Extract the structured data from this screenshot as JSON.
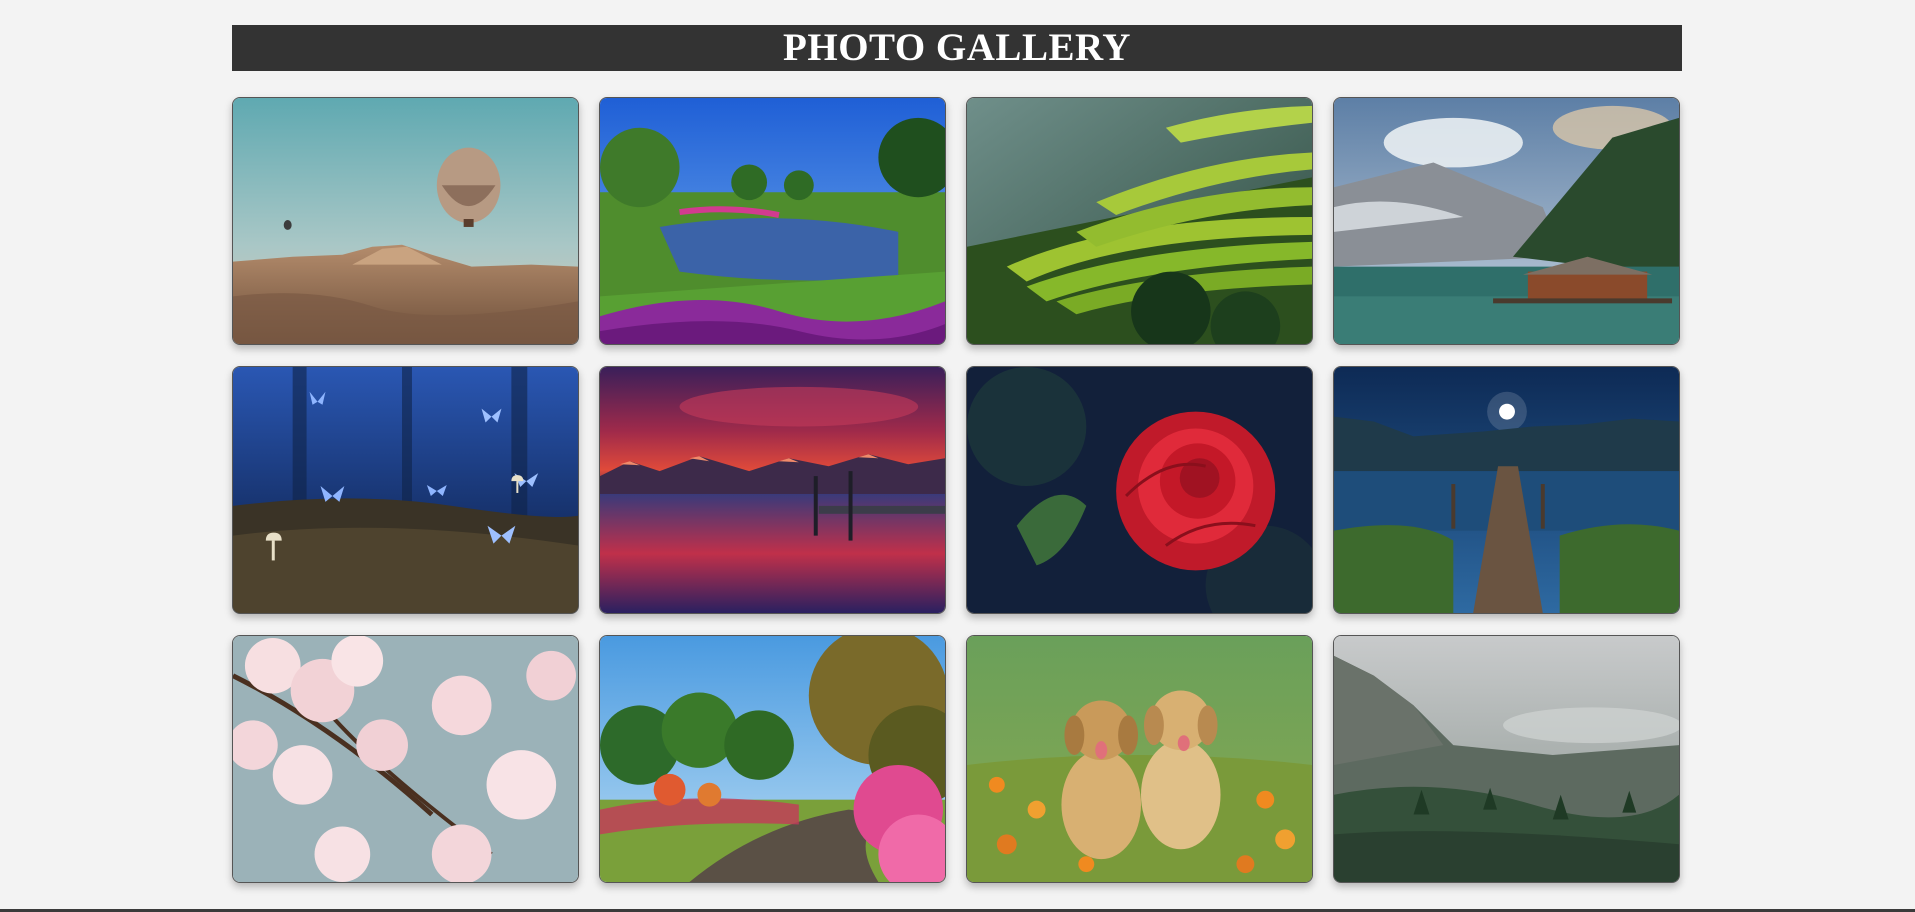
{
  "header": {
    "title": "PHOTO GALLERY"
  },
  "colors": {
    "page_background": "#f3f3f3",
    "header_background": "#333333",
    "header_text": "#ffffff"
  },
  "gallery": {
    "photos": [
      {
        "subject": "hot-air-balloons-desert"
      },
      {
        "subject": "garden-river-bridge"
      },
      {
        "subject": "green-rice-terraces"
      },
      {
        "subject": "mountain-lake-cabin"
      },
      {
        "subject": "blue-butterflies-night"
      },
      {
        "subject": "sunset-lake-pier"
      },
      {
        "subject": "red-rose"
      },
      {
        "subject": "moonlit-lake-dock"
      },
      {
        "subject": "cherry-blossoms"
      },
      {
        "subject": "garden-path-flowers"
      },
      {
        "subject": "golden-retriever-puppies"
      },
      {
        "subject": "misty-mountain-forest"
      }
    ]
  }
}
